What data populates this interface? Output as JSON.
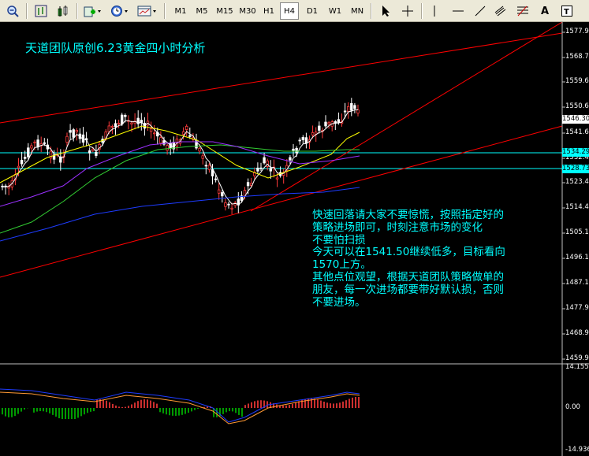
{
  "toolbar": {
    "timeframes": [
      "M1",
      "M5",
      "M15",
      "M30",
      "H1",
      "H4",
      "D1",
      "W1",
      "MN"
    ],
    "active_timeframe": "H4"
  },
  "annotation": {
    "title": "天道团队原创6.23黄金四小时分析",
    "lines": [
      "快速回落请大家不要惊慌，按照指定好的",
      "策略进场即可，时刻注意市场的变化",
      "不要怕扫损",
      "今天可以在1541.50继续低多，目标看向",
      "1570上方。",
      "其他点位观望，根据天道团队策略做单的",
      "朋友，每一次进场都要带好默认损，否则",
      "不要进场。"
    ]
  },
  "price_axis": {
    "labels": [
      "1577.90",
      "1568.70",
      "1559.65",
      "1550.65",
      "1541.65",
      "1532.45",
      "1523.40",
      "1514.40",
      "1505.15",
      "1496.15",
      "1487.15",
      "1477.90",
      "1468.90",
      "1459.90"
    ],
    "current_price": "1546.30",
    "hline_labels": [
      "1534.29",
      "1528.73"
    ]
  },
  "indicator_axis": {
    "labels": [
      "14.1556",
      "0.00",
      "-14.9365"
    ]
  },
  "colors": {
    "background": "#000000",
    "bull": "#ff3b3b",
    "bear": "#ffffff",
    "channel": "#ff0000",
    "hline": "#00ffff",
    "ma_fast": "#ffffff",
    "ma_yellow": "#ffff00",
    "ma_green": "#32cd32",
    "ma_purple": "#9b30ff",
    "ma_blue": "#1e3cff",
    "text": "#00ffff"
  },
  "icons": [
    "zoom-icon",
    "chart-type-icon",
    "chart-bars-icon",
    "add-indicator-icon",
    "clock-icon",
    "template-icon",
    "cursor-icon",
    "crosshair-icon",
    "vertical-line-icon",
    "horizontal-line-icon",
    "trendline-icon",
    "channel-icon",
    "fibonacci-icon",
    "text-icon",
    "label-icon"
  ]
}
